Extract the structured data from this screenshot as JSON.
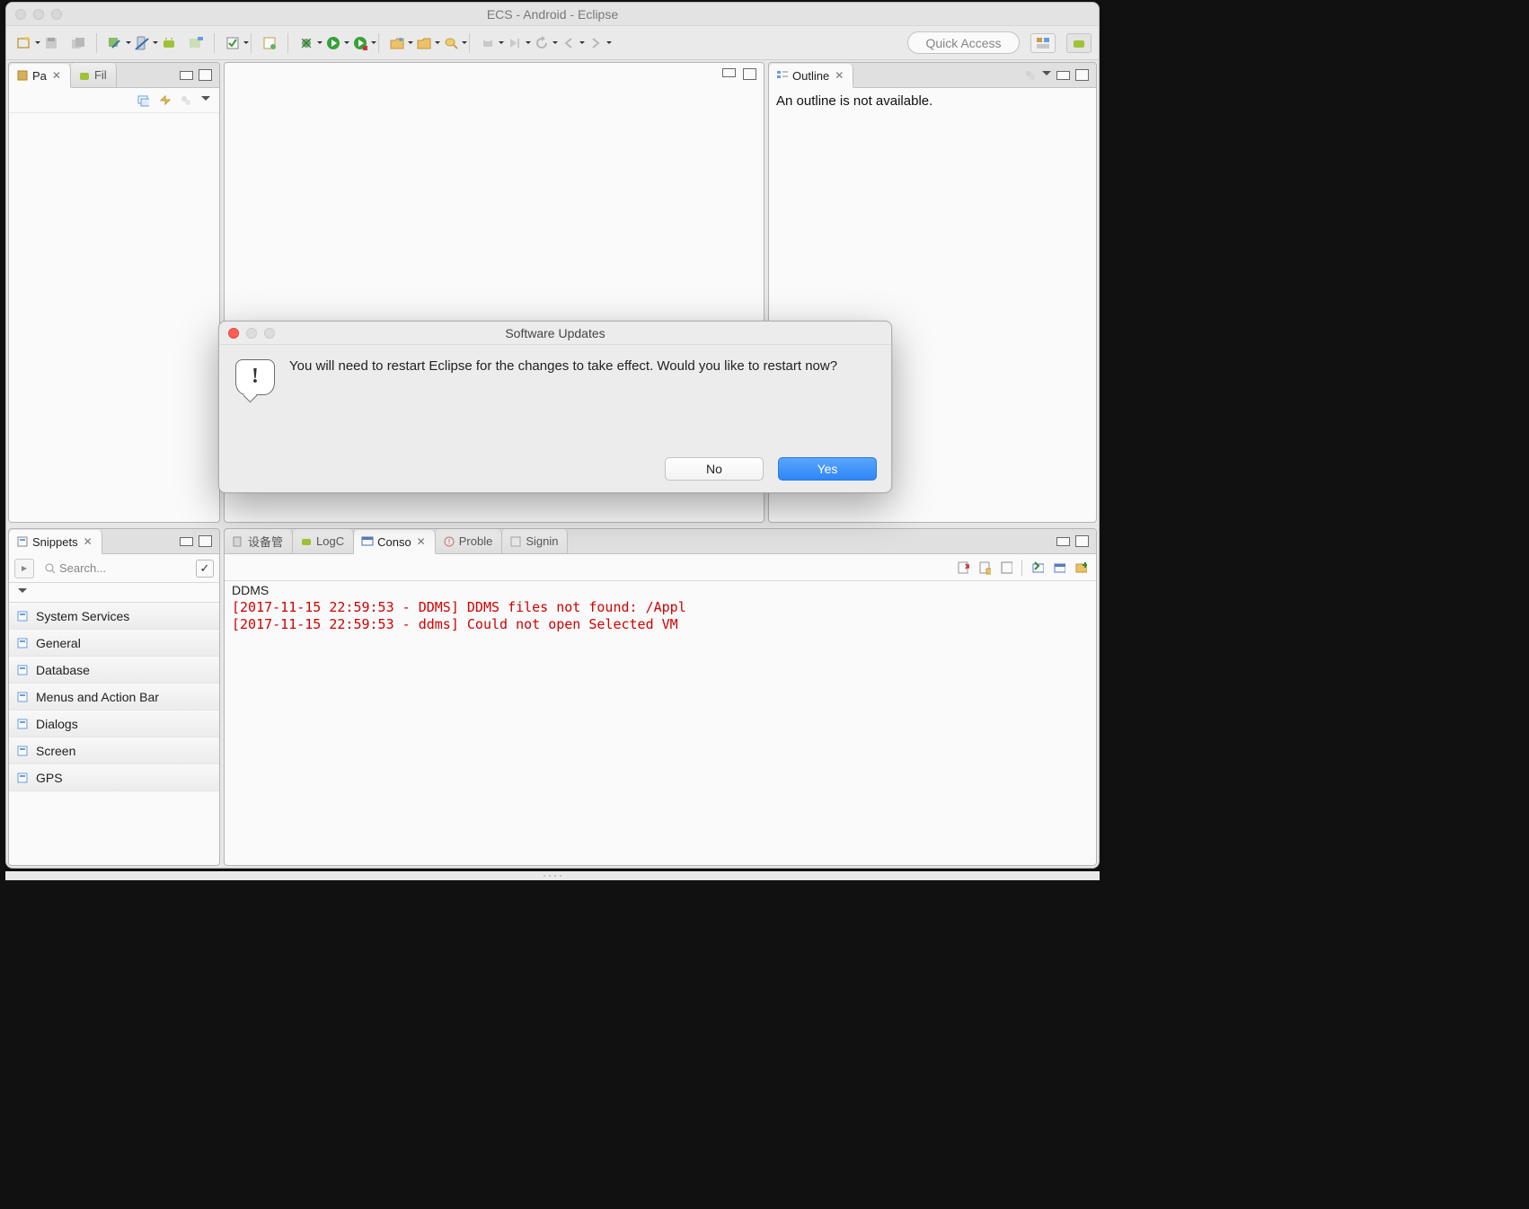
{
  "window": {
    "title": "ECS - Android - Eclipse"
  },
  "toolbar": {
    "quick_access_placeholder": "Quick Access"
  },
  "views": {
    "package_explorer": {
      "tab": "Pa"
    },
    "file_explorer": {
      "tab": "Fil"
    },
    "outline": {
      "tab": "Outline",
      "message": "An outline is not available."
    },
    "snippets": {
      "tab": "Snippets",
      "search_placeholder": "Search...",
      "items": [
        "System Services",
        "General",
        "Database",
        "Menus and Action Bar",
        "Dialogs",
        "Screen",
        "GPS"
      ]
    }
  },
  "console": {
    "tab_devices": "设备管",
    "tab_logc": "LogC",
    "tab_console": "Conso",
    "tab_problems": "Proble",
    "tab_signin": "Signin",
    "label": "DDMS",
    "lines": [
      "[2017-11-15 22:59:53 - DDMS] DDMS files not found: /Appl",
      "[2017-11-15 22:59:53 - ddms] Could not open Selected VM "
    ]
  },
  "dialog": {
    "title": "Software Updates",
    "message": "You will need to restart Eclipse for the changes to take effect. Would you like to restart now?",
    "no": "No",
    "yes": "Yes"
  }
}
